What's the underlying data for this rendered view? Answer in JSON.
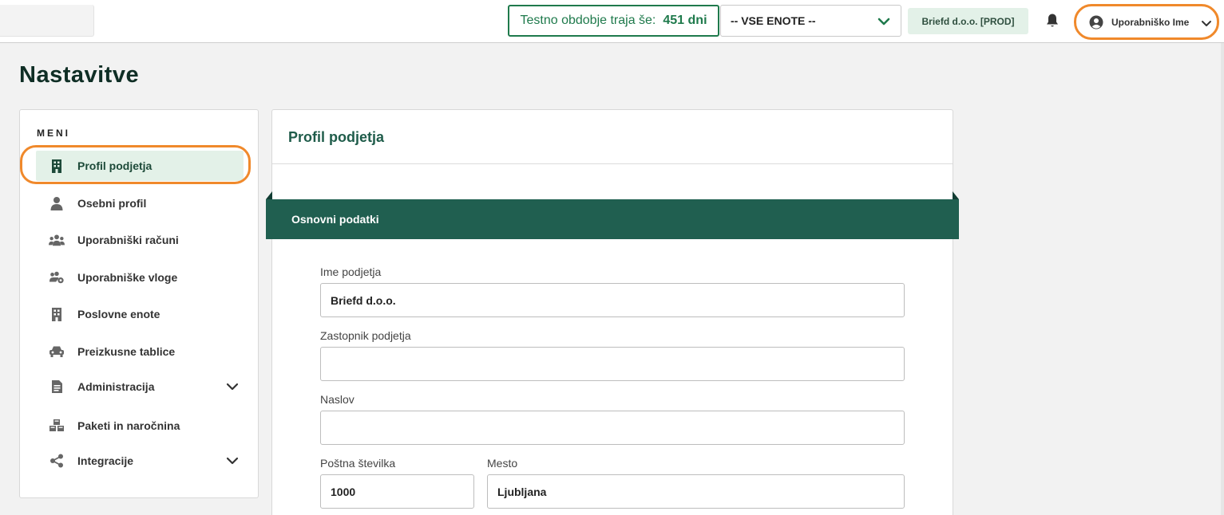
{
  "topbar": {
    "trial_label": "Testno obdobje traja še:",
    "trial_days": "451 dni",
    "unit_select_value": "-- VSE ENOTE --",
    "company_badge": "Briefd d.o.o. [PROD]",
    "user_name": "Uporabniško Ime"
  },
  "page": {
    "title": "Nastavitve"
  },
  "sidebar": {
    "heading": "MENI",
    "items": [
      {
        "label": "Profil podjetja",
        "icon": "building-icon",
        "active": true
      },
      {
        "label": "Osebni profil",
        "icon": "person-icon"
      },
      {
        "label": "Uporabniški računi",
        "icon": "users-icon"
      },
      {
        "label": "Uporabniške vloge",
        "icon": "users-cog-icon"
      },
      {
        "label": "Poslovne enote",
        "icon": "building-icon"
      },
      {
        "label": "Preizkusne tablice",
        "icon": "car-icon"
      },
      {
        "label": "Administracija",
        "icon": "document-icon",
        "expandable": true
      },
      {
        "label": "Paketi in naročnina",
        "icon": "cubes-icon"
      },
      {
        "label": "Integracije",
        "icon": "share-icon",
        "expandable": true
      }
    ]
  },
  "main": {
    "title": "Profil podjetja",
    "section_title": "Osnovni podatki",
    "fields": {
      "company_name": {
        "label": "Ime podjetja",
        "value": "Briefd d.o.o."
      },
      "representative": {
        "label": "Zastopnik podjetja",
        "value": ""
      },
      "address": {
        "label": "Naslov",
        "value": ""
      },
      "postal_code": {
        "label": "Poštna številka",
        "value": "1000"
      },
      "city": {
        "label": "Mesto",
        "value": "Ljubljana"
      }
    }
  },
  "colors": {
    "brand_green": "#205f50",
    "accent_green": "#1f7a4c",
    "highlight_orange": "#f0892b",
    "active_bg": "#e3f1e8"
  }
}
